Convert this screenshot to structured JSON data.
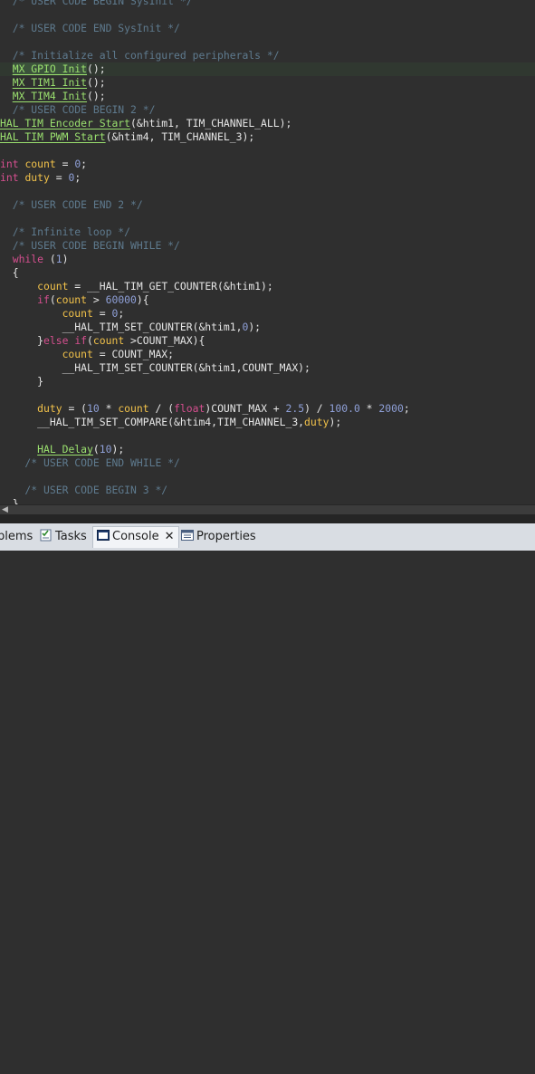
{
  "editor": {
    "lines": [
      [
        {
          "t": "  /* USER CODE BEGIN SysInit */",
          "c": "comment"
        }
      ],
      [],
      [
        {
          "t": "  /* USER CODE END SysInit */",
          "c": "comment"
        }
      ],
      [],
      [
        {
          "t": "  /* Initialize all configured peripherals */",
          "c": "comment"
        }
      ],
      [
        {
          "t": "  ",
          "c": "plain"
        },
        {
          "t": "MX_GPIO_Init",
          "c": "hl-fn"
        },
        {
          "t": "();",
          "c": "plain"
        }
      ],
      [
        {
          "t": "  ",
          "c": "plain"
        },
        {
          "t": "MX_TIM1_Init",
          "c": "fn"
        },
        {
          "t": "();",
          "c": "plain"
        }
      ],
      [
        {
          "t": "  ",
          "c": "plain"
        },
        {
          "t": "MX_TIM4_Init",
          "c": "fn"
        },
        {
          "t": "();",
          "c": "plain"
        }
      ],
      [
        {
          "t": "  /* USER CODE BEGIN 2 */",
          "c": "comment"
        }
      ],
      [
        {
          "t": "HAL_TIM_Encoder_Start",
          "c": "fn"
        },
        {
          "t": "(&htim1, TIM_CHANNEL_ALL);",
          "c": "plain"
        }
      ],
      [
        {
          "t": "HAL_TIM_PWM_Start",
          "c": "fn"
        },
        {
          "t": "(&htim4, TIM_CHANNEL_3);",
          "c": "plain"
        }
      ],
      [],
      [
        {
          "t": "int",
          "c": "kw"
        },
        {
          "t": " ",
          "c": "plain"
        },
        {
          "t": "count",
          "c": "var"
        },
        {
          "t": " = ",
          "c": "plain"
        },
        {
          "t": "0",
          "c": "num"
        },
        {
          "t": ";",
          "c": "plain"
        }
      ],
      [
        {
          "t": "int",
          "c": "kw"
        },
        {
          "t": " ",
          "c": "plain"
        },
        {
          "t": "duty",
          "c": "var"
        },
        {
          "t": " = ",
          "c": "plain"
        },
        {
          "t": "0",
          "c": "num"
        },
        {
          "t": ";",
          "c": "plain"
        }
      ],
      [],
      [
        {
          "t": "  /* USER CODE END 2 */",
          "c": "comment"
        }
      ],
      [],
      [
        {
          "t": "  /* Infinite loop */",
          "c": "comment"
        }
      ],
      [
        {
          "t": "  /* USER CODE BEGIN WHILE */",
          "c": "comment"
        }
      ],
      [
        {
          "t": "  ",
          "c": "plain"
        },
        {
          "t": "while",
          "c": "kw"
        },
        {
          "t": " (",
          "c": "plain"
        },
        {
          "t": "1",
          "c": "num"
        },
        {
          "t": ")",
          "c": "plain"
        }
      ],
      [
        {
          "t": "  {",
          "c": "plain"
        }
      ],
      [
        {
          "t": "      ",
          "c": "plain"
        },
        {
          "t": "count",
          "c": "var"
        },
        {
          "t": " = __HAL_TIM_GET_COUNTER(&htim1);",
          "c": "plain"
        }
      ],
      [
        {
          "t": "      ",
          "c": "plain"
        },
        {
          "t": "if",
          "c": "kw"
        },
        {
          "t": "(",
          "c": "plain"
        },
        {
          "t": "count",
          "c": "var"
        },
        {
          "t": " > ",
          "c": "plain"
        },
        {
          "t": "60000",
          "c": "num"
        },
        {
          "t": "){",
          "c": "plain"
        }
      ],
      [
        {
          "t": "          ",
          "c": "plain"
        },
        {
          "t": "count",
          "c": "var"
        },
        {
          "t": " = ",
          "c": "plain"
        },
        {
          "t": "0",
          "c": "num"
        },
        {
          "t": ";",
          "c": "plain"
        }
      ],
      [
        {
          "t": "          __HAL_TIM_SET_COUNTER(&htim1,",
          "c": "plain"
        },
        {
          "t": "0",
          "c": "num"
        },
        {
          "t": ");",
          "c": "plain"
        }
      ],
      [
        {
          "t": "      }",
          "c": "plain"
        },
        {
          "t": "else",
          "c": "kw"
        },
        {
          "t": " ",
          "c": "plain"
        },
        {
          "t": "if",
          "c": "kw"
        },
        {
          "t": "(",
          "c": "plain"
        },
        {
          "t": "count",
          "c": "var"
        },
        {
          "t": " >COUNT_MAX){",
          "c": "plain"
        }
      ],
      [
        {
          "t": "          ",
          "c": "plain"
        },
        {
          "t": "count",
          "c": "var"
        },
        {
          "t": " = COUNT_MAX;",
          "c": "plain"
        }
      ],
      [
        {
          "t": "          __HAL_TIM_SET_COUNTER(&htim1,COUNT_MAX);",
          "c": "plain"
        }
      ],
      [
        {
          "t": "      }",
          "c": "plain"
        }
      ],
      [],
      [
        {
          "t": "      ",
          "c": "plain"
        },
        {
          "t": "duty",
          "c": "var"
        },
        {
          "t": " = (",
          "c": "plain"
        },
        {
          "t": "10",
          "c": "num"
        },
        {
          "t": " * ",
          "c": "plain"
        },
        {
          "t": "count",
          "c": "var"
        },
        {
          "t": " / (",
          "c": "plain"
        },
        {
          "t": "float",
          "c": "kw"
        },
        {
          "t": ")COUNT_MAX + ",
          "c": "plain"
        },
        {
          "t": "2.5",
          "c": "num"
        },
        {
          "t": ") / ",
          "c": "plain"
        },
        {
          "t": "100.0",
          "c": "num"
        },
        {
          "t": " * ",
          "c": "plain"
        },
        {
          "t": "2000",
          "c": "num"
        },
        {
          "t": ";",
          "c": "plain"
        }
      ],
      [
        {
          "t": "      __HAL_TIM_SET_COMPARE(&htim4,TIM_CHANNEL_3,",
          "c": "plain"
        },
        {
          "t": "duty",
          "c": "var"
        },
        {
          "t": ");",
          "c": "plain"
        }
      ],
      [],
      [
        {
          "t": "      ",
          "c": "plain"
        },
        {
          "t": "HAL_Delay",
          "c": "fn"
        },
        {
          "t": "(",
          "c": "plain"
        },
        {
          "t": "10",
          "c": "num"
        },
        {
          "t": ");",
          "c": "plain"
        }
      ],
      [
        {
          "t": "    /* USER CODE END WHILE */",
          "c": "comment"
        }
      ],
      [],
      [
        {
          "t": "    /* USER CODE BEGIN 3 */",
          "c": "comment"
        }
      ],
      [
        {
          "t": "  }",
          "c": "plain"
        }
      ]
    ],
    "current_line": 5
  },
  "tabs": [
    {
      "label": "blems",
      "icon": "problems-icon",
      "active": false,
      "name": "tab-problems"
    },
    {
      "label": "Tasks",
      "icon": "tasks-icon",
      "active": false,
      "name": "tab-tasks"
    },
    {
      "label": "Console",
      "icon": "console-icon",
      "active": true,
      "name": "tab-console"
    },
    {
      "label": "Properties",
      "icon": "properties-icon",
      "active": false,
      "name": "tab-properties"
    }
  ],
  "colors": {
    "editor_bg": "#2f2f2f",
    "comment": "#5e7a8e",
    "keyword": "#d54f8f",
    "function": "#9be16f",
    "number": "#8fa0d8",
    "variable": "#f2c24a"
  }
}
